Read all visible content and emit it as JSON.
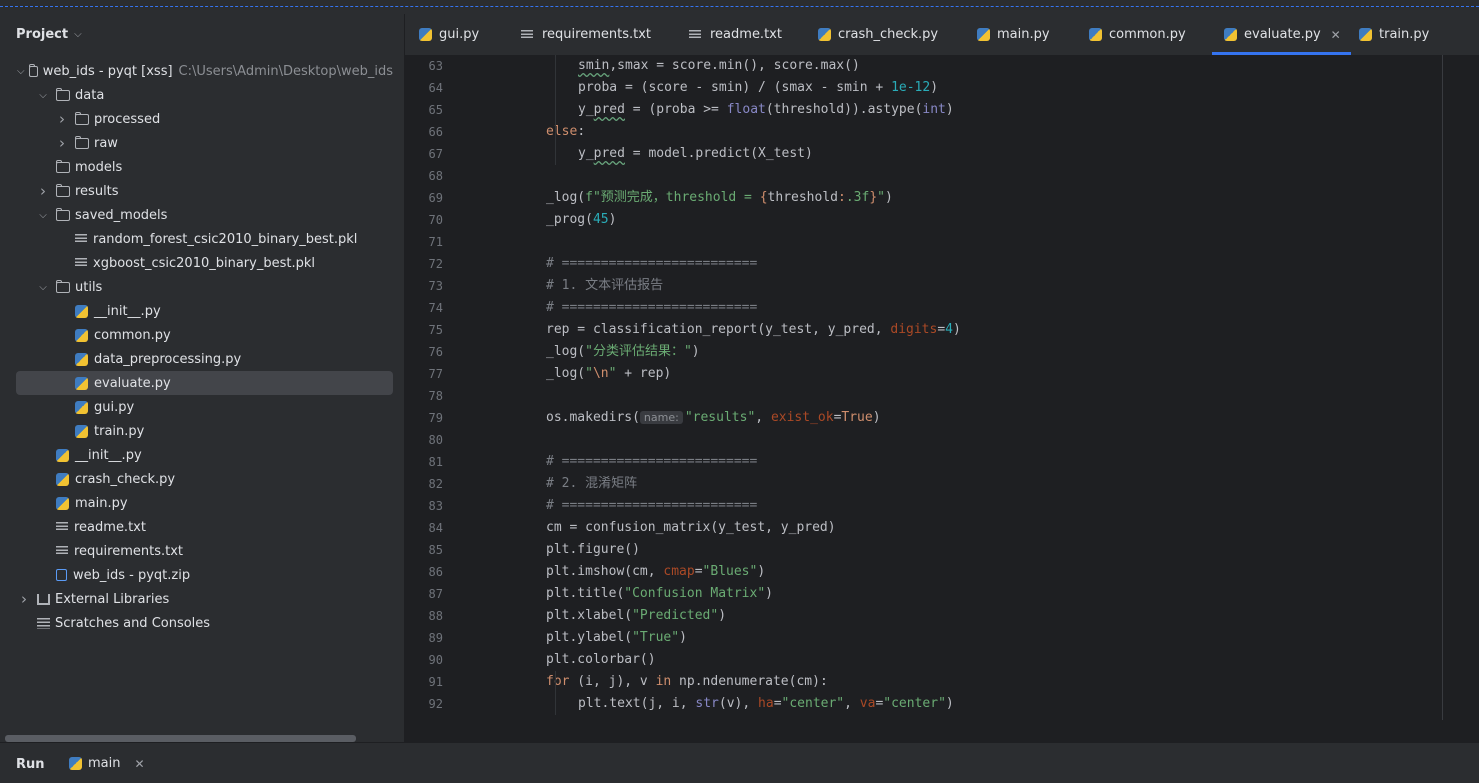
{
  "project": {
    "header": "Project",
    "tree": [
      {
        "label": "web_ids - pyqt [xss]",
        "path": "C:\\Users\\Admin\\Desktop\\web_ids",
        "type": "folder",
        "arrow": "down",
        "indent": 0
      },
      {
        "label": "data",
        "type": "folder",
        "arrow": "down",
        "indent": 1
      },
      {
        "label": "processed",
        "type": "folder",
        "arrow": "right",
        "indent": 2
      },
      {
        "label": "raw",
        "type": "folder",
        "arrow": "right",
        "indent": 2
      },
      {
        "label": "models",
        "type": "folder",
        "arrow": "",
        "indent": 1
      },
      {
        "label": "results",
        "type": "folder",
        "arrow": "right",
        "indent": 1
      },
      {
        "label": "saved_models",
        "type": "folder",
        "arrow": "down",
        "indent": 1
      },
      {
        "label": "random_forest_csic2010_binary_best.pkl",
        "type": "text",
        "arrow": "",
        "indent": 2
      },
      {
        "label": "xgboost_csic2010_binary_best.pkl",
        "type": "text",
        "arrow": "",
        "indent": 2
      },
      {
        "label": "utils",
        "type": "folder",
        "arrow": "down",
        "indent": 1
      },
      {
        "label": "__init__.py",
        "type": "python",
        "arrow": "",
        "indent": 2
      },
      {
        "label": "common.py",
        "type": "python",
        "arrow": "",
        "indent": 2
      },
      {
        "label": "data_preprocessing.py",
        "type": "python",
        "arrow": "",
        "indent": 2
      },
      {
        "label": "evaluate.py",
        "type": "python",
        "arrow": "",
        "indent": 2,
        "selected": true
      },
      {
        "label": "gui.py",
        "type": "python",
        "arrow": "",
        "indent": 2
      },
      {
        "label": "train.py",
        "type": "python",
        "arrow": "",
        "indent": 2
      },
      {
        "label": "__init__.py",
        "type": "python",
        "arrow": "",
        "indent": 1
      },
      {
        "label": "crash_check.py",
        "type": "python",
        "arrow": "",
        "indent": 1
      },
      {
        "label": "main.py",
        "type": "python",
        "arrow": "",
        "indent": 1
      },
      {
        "label": "readme.txt",
        "type": "text",
        "arrow": "",
        "indent": 1
      },
      {
        "label": "requirements.txt",
        "type": "text",
        "arrow": "",
        "indent": 1
      },
      {
        "label": "web_ids - pyqt.zip",
        "type": "zip",
        "arrow": "",
        "indent": 1
      },
      {
        "label": "External Libraries",
        "type": "library",
        "arrow": "right",
        "indent": 0
      },
      {
        "label": "Scratches and Consoles",
        "type": "scratch",
        "arrow": "",
        "indent": 0
      }
    ]
  },
  "tabs": [
    {
      "label": "gui.py",
      "type": "python"
    },
    {
      "label": "requirements.txt",
      "type": "text"
    },
    {
      "label": "readme.txt",
      "type": "text"
    },
    {
      "label": "crash_check.py",
      "type": "python"
    },
    {
      "label": "main.py",
      "type": "python"
    },
    {
      "label": "common.py",
      "type": "python"
    },
    {
      "label": "evaluate.py",
      "type": "python",
      "active": true,
      "close": "✕"
    },
    {
      "label": "train.py",
      "type": "python"
    }
  ],
  "editor": {
    "lines": [
      {
        "n": "63",
        "indent": 2,
        "tokens": [
          [
            "uw",
            "smin"
          ],
          [
            "",
            ","
          ],
          [
            "",
            "smax = score.min(), score.max()"
          ]
        ]
      },
      {
        "n": "64",
        "indent": 2,
        "tokens": [
          [
            "",
            "proba = (score - smin) / (smax - smin + "
          ],
          [
            "num",
            "1e-12"
          ],
          [
            "",
            ")"
          ]
        ]
      },
      {
        "n": "65",
        "indent": 2,
        "tokens": [
          [
            "",
            "y_"
          ],
          [
            "uw",
            "pred"
          ],
          [
            "",
            " = (proba >= "
          ],
          [
            "bi",
            "float"
          ],
          [
            "",
            "(threshold)).astype("
          ],
          [
            "bi",
            "int"
          ],
          [
            "",
            ")"
          ]
        ]
      },
      {
        "n": "66",
        "indent": 1,
        "tokens": [
          [
            "kw",
            "else"
          ],
          [
            "",
            ":"
          ]
        ]
      },
      {
        "n": "67",
        "indent": 2,
        "tokens": [
          [
            "",
            "y_"
          ],
          [
            "uw",
            "pred"
          ],
          [
            "",
            " = model.predict(X_test)"
          ]
        ]
      },
      {
        "n": "68",
        "indent": 0,
        "tokens": []
      },
      {
        "n": "69",
        "indent": 1,
        "tokens": [
          [
            "",
            "_log("
          ],
          [
            "str",
            "f\"预测完成，threshold = "
          ],
          [
            "kw",
            "{"
          ],
          [
            "bl",
            "threshold"
          ],
          [
            "kw",
            ":"
          ],
          [
            "str",
            ".3f"
          ],
          [
            "kw",
            "}"
          ],
          [
            "str",
            "\""
          ],
          [
            "",
            ")"
          ]
        ]
      },
      {
        "n": "70",
        "indent": 1,
        "tokens": [
          [
            "",
            "_prog("
          ],
          [
            "num",
            "45"
          ],
          [
            "",
            ")"
          ]
        ]
      },
      {
        "n": "71",
        "indent": 0,
        "tokens": []
      },
      {
        "n": "72",
        "indent": 1,
        "tokens": [
          [
            "cm",
            "# ========================="
          ]
        ]
      },
      {
        "n": "73",
        "indent": 1,
        "tokens": [
          [
            "cm",
            "# 1. 文本评估报告"
          ]
        ]
      },
      {
        "n": "74",
        "indent": 1,
        "tokens": [
          [
            "cm",
            "# ========================="
          ]
        ]
      },
      {
        "n": "75",
        "indent": 1,
        "tokens": [
          [
            "",
            "rep = classification_report(y_test, y_pred, "
          ],
          [
            "pn",
            "digits"
          ],
          [
            "",
            "="
          ],
          [
            "num",
            "4"
          ],
          [
            "",
            ")"
          ]
        ]
      },
      {
        "n": "76",
        "indent": 1,
        "tokens": [
          [
            "",
            "_log("
          ],
          [
            "str",
            "\"分类评估结果：\""
          ],
          [
            "",
            ")"
          ]
        ]
      },
      {
        "n": "77",
        "indent": 1,
        "tokens": [
          [
            "",
            "_log("
          ],
          [
            "str",
            "\""
          ],
          [
            "kw",
            "\\n"
          ],
          [
            "str",
            "\""
          ],
          [
            "",
            " + rep)"
          ]
        ]
      },
      {
        "n": "78",
        "indent": 0,
        "tokens": []
      },
      {
        "n": "79",
        "indent": 1,
        "tokens": [
          [
            "",
            "os.makedirs("
          ],
          [
            "hint",
            "name:"
          ],
          [
            "str",
            "\"results\""
          ],
          [
            "",
            ", "
          ],
          [
            "pn",
            "exist_ok"
          ],
          [
            "",
            "="
          ],
          [
            "kw",
            "True"
          ],
          [
            "",
            ")"
          ]
        ]
      },
      {
        "n": "80",
        "indent": 0,
        "tokens": []
      },
      {
        "n": "81",
        "indent": 1,
        "tokens": [
          [
            "cm",
            "# ========================="
          ]
        ]
      },
      {
        "n": "82",
        "indent": 1,
        "tokens": [
          [
            "cm",
            "# 2. 混淆矩阵"
          ]
        ]
      },
      {
        "n": "83",
        "indent": 1,
        "tokens": [
          [
            "cm",
            "# ========================="
          ]
        ]
      },
      {
        "n": "84",
        "indent": 1,
        "tokens": [
          [
            "",
            "cm = confusion_matrix(y_test, y_pred)"
          ]
        ]
      },
      {
        "n": "85",
        "indent": 1,
        "tokens": [
          [
            "",
            "plt.figure()"
          ]
        ]
      },
      {
        "n": "86",
        "indent": 1,
        "tokens": [
          [
            "",
            "plt.imshow(cm, "
          ],
          [
            "pn",
            "cmap"
          ],
          [
            "",
            "="
          ],
          [
            "str",
            "\"Blues\""
          ],
          [
            "",
            ")"
          ]
        ]
      },
      {
        "n": "87",
        "indent": 1,
        "tokens": [
          [
            "",
            "plt.title("
          ],
          [
            "str",
            "\"Confusion Matrix\""
          ],
          [
            "",
            ")"
          ]
        ]
      },
      {
        "n": "88",
        "indent": 1,
        "tokens": [
          [
            "",
            "plt.xlabel("
          ],
          [
            "str",
            "\"Predicted\""
          ],
          [
            "",
            ")"
          ]
        ]
      },
      {
        "n": "89",
        "indent": 1,
        "tokens": [
          [
            "",
            "plt.ylabel("
          ],
          [
            "str",
            "\"True\""
          ],
          [
            "",
            ")"
          ]
        ]
      },
      {
        "n": "90",
        "indent": 1,
        "tokens": [
          [
            "",
            "plt.colorbar()"
          ]
        ]
      },
      {
        "n": "91",
        "indent": 1,
        "tokens": [
          [
            "kw",
            "for"
          ],
          [
            "",
            " (i, j), v "
          ],
          [
            "kw",
            "in"
          ],
          [
            "",
            " np.ndenumerate(cm):"
          ]
        ]
      },
      {
        "n": "92",
        "indent": 2,
        "tokens": [
          [
            "",
            "plt.text(j, i, "
          ],
          [
            "bi",
            "str"
          ],
          [
            "",
            "(v), "
          ],
          [
            "pn",
            "ha"
          ],
          [
            "",
            "="
          ],
          [
            "str",
            "\"center\""
          ],
          [
            "",
            ", "
          ],
          [
            "pn",
            "va"
          ],
          [
            "",
            "="
          ],
          [
            "str",
            "\"center\""
          ],
          [
            "",
            ")"
          ]
        ]
      }
    ]
  },
  "run": {
    "label": "Run",
    "tab": "main",
    "close": "✕"
  }
}
